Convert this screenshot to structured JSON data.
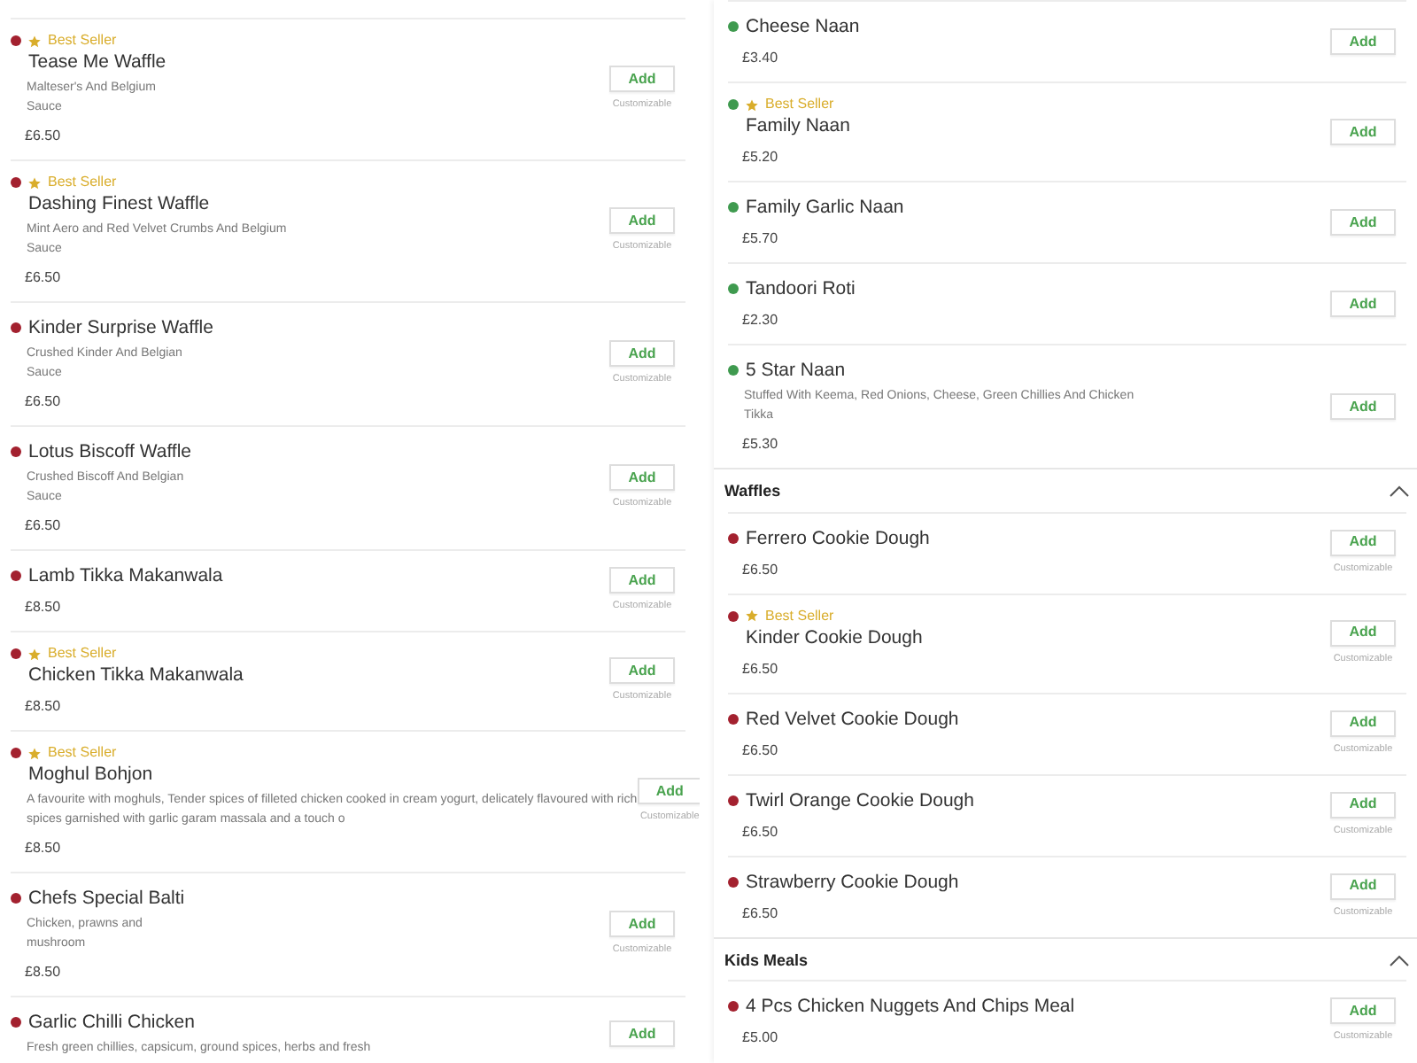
{
  "columns": [
    {
      "sections": [
        {
          "items": [
            {
              "color": "#a3212f",
              "best_seller": "Best Seller",
              "name": "Tease Me Waffle",
              "description": [
                "Malteser's And Belgium",
                "Sauce"
              ],
              "price": "£6.50",
              "button": "Add",
              "note": "Customizable"
            },
            {
              "color": "#a3212f",
              "best_seller": "Best Seller",
              "name": "Dashing Finest Waffle",
              "description": [
                "Mint Aero and Red Velvet Crumbs And Belgium",
                "Sauce"
              ],
              "price": "£6.50",
              "button": "Add",
              "note": "Customizable"
            },
            {
              "color": "#a3212f",
              "name": "Kinder Surprise Waffle",
              "description": [
                "Crushed Kinder And Belgian",
                "Sauce"
              ],
              "price": "£6.50",
              "button": "Add",
              "note": "Customizable"
            },
            {
              "color": "#a3212f",
              "name": "Lotus Biscoff Waffle",
              "description": [
                "Crushed Biscoff And Belgian",
                "Sauce"
              ],
              "price": "£6.50",
              "button": "Add",
              "note": "Customizable"
            },
            {
              "color": "#a3212f",
              "name": "Lamb Tikka Makanwala",
              "price": "£8.50",
              "button": "Add",
              "note": "Customizable"
            },
            {
              "color": "#a3212f",
              "best_seller": "Best Seller",
              "name": "Chicken Tikka Makanwala",
              "price": "£8.50",
              "button": "Add",
              "note": "Customizable"
            },
            {
              "color": "#a3212f",
              "best_seller": "Best Seller",
              "name": "Moghul Bohjon",
              "description": [
                "A favourite with moghuls, Tender spices of filleted chicken cooked in cream yogurt, delicately flavoured with rich",
                "spices garnished with garlic garam massala and a touch o"
              ],
              "price": "£8.50",
              "button": "Add",
              "note": "Customizable"
            },
            {
              "color": "#a3212f",
              "name": "Chefs Special Balti",
              "description": [
                "Chicken, prawns and",
                "mushroom"
              ],
              "price": "£8.50",
              "button": "Add",
              "note": "Customizable"
            },
            {
              "color": "#a3212f",
              "name": "Garlic Chilli Chicken",
              "description": [
                "Fresh green chillies, capsicum, ground spices, herbs and fresh"
              ],
              "button": "Add"
            }
          ]
        }
      ]
    },
    {
      "sections": [
        {
          "items": [
            {
              "color": "#3f9a4f",
              "name": "Cheese Naan",
              "price": "£3.40",
              "button": "Add"
            },
            {
              "color": "#3f9a4f",
              "best_seller": "Best Seller",
              "name": "Family Naan",
              "price": "£5.20",
              "button": "Add"
            },
            {
              "color": "#3f9a4f",
              "name": "Family Garlic Naan",
              "price": "£5.70",
              "button": "Add"
            },
            {
              "color": "#3f9a4f",
              "name": "Tandoori Roti",
              "price": "£2.30",
              "button": "Add"
            },
            {
              "color": "#3f9a4f",
              "name": "5 Star Naan",
              "description": [
                "Stuffed With Keema, Red Onions, Cheese, Green Chillies And Chicken",
                "Tikka"
              ],
              "price": "£5.30",
              "button": "Add"
            }
          ]
        },
        {
          "title": "Waffles",
          "expanded": true,
          "items": [
            {
              "color": "#a3212f",
              "name": "Ferrero Cookie Dough",
              "price": "£6.50",
              "button": "Add",
              "note": "Customizable"
            },
            {
              "color": "#a3212f",
              "best_seller": "Best Seller",
              "name": "Kinder Cookie Dough",
              "price": "£6.50",
              "button": "Add",
              "note": "Customizable"
            },
            {
              "color": "#a3212f",
              "name": "Red Velvet Cookie Dough",
              "price": "£6.50",
              "button": "Add",
              "note": "Customizable"
            },
            {
              "color": "#a3212f",
              "name": "Twirl Orange Cookie Dough",
              "price": "£6.50",
              "button": "Add",
              "note": "Customizable"
            },
            {
              "color": "#a3212f",
              "name": "Strawberry Cookie Dough",
              "price": "£6.50",
              "button": "Add",
              "note": "Customizable"
            }
          ]
        },
        {
          "title": "Kids Meals",
          "expanded": true,
          "items": [
            {
              "color": "#a3212f",
              "name": "4 Pcs Chicken Nuggets And Chips Meal",
              "price": "£5.00",
              "button": "Add",
              "note": "Customizable"
            }
          ]
        }
      ]
    }
  ]
}
